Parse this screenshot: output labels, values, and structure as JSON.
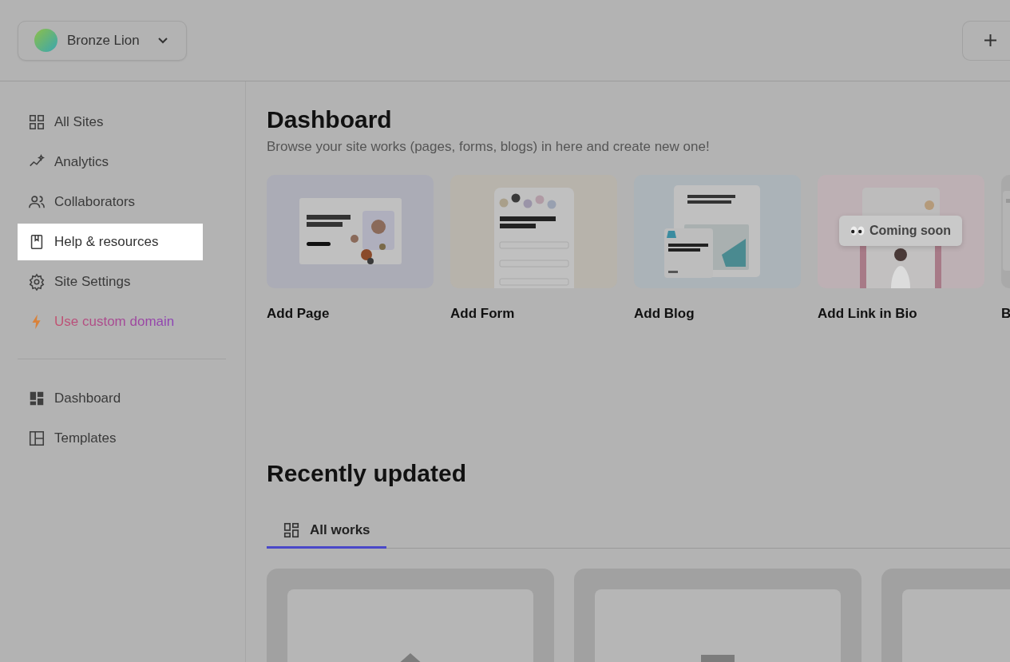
{
  "workspace": {
    "name": "Bronze Lion"
  },
  "sidebar": {
    "items": [
      {
        "label": "All Sites",
        "kind": "normal",
        "selected": false
      },
      {
        "label": "Analytics",
        "kind": "normal",
        "selected": false
      },
      {
        "label": "Collaborators",
        "kind": "normal",
        "selected": false
      },
      {
        "label": "Help & resources",
        "kind": "normal",
        "selected": true
      },
      {
        "label": "Site Settings",
        "kind": "normal",
        "selected": false
      },
      {
        "label": "Use custom domain",
        "kind": "promo",
        "selected": false
      }
    ],
    "secondary_items": [
      {
        "label": "Dashboard",
        "selected": false
      },
      {
        "label": "Templates",
        "selected": false
      }
    ]
  },
  "main": {
    "title": "Dashboard",
    "subtitle": "Browse your site works (pages, forms, blogs) in here and create new one!",
    "create_cards": [
      {
        "label": "Add Page",
        "preview": {
          "kind": "page"
        }
      },
      {
        "label": "Add Form",
        "preview": {
          "kind": "form"
        }
      },
      {
        "label": "Add Blog",
        "preview": {
          "kind": "blog"
        }
      },
      {
        "label": "Add Link in Bio",
        "preview": {
          "kind": "link",
          "badge": "Coming soon"
        }
      },
      {
        "label": "B",
        "preview": {
          "kind": "cut"
        }
      }
    ],
    "recent": {
      "title": "Recently updated",
      "tabs": [
        {
          "label": "All works",
          "selected": true
        }
      ],
      "works": [
        {
          "kind": "home"
        },
        {
          "kind": "square"
        },
        {
          "kind": "blank"
        }
      ]
    }
  }
}
